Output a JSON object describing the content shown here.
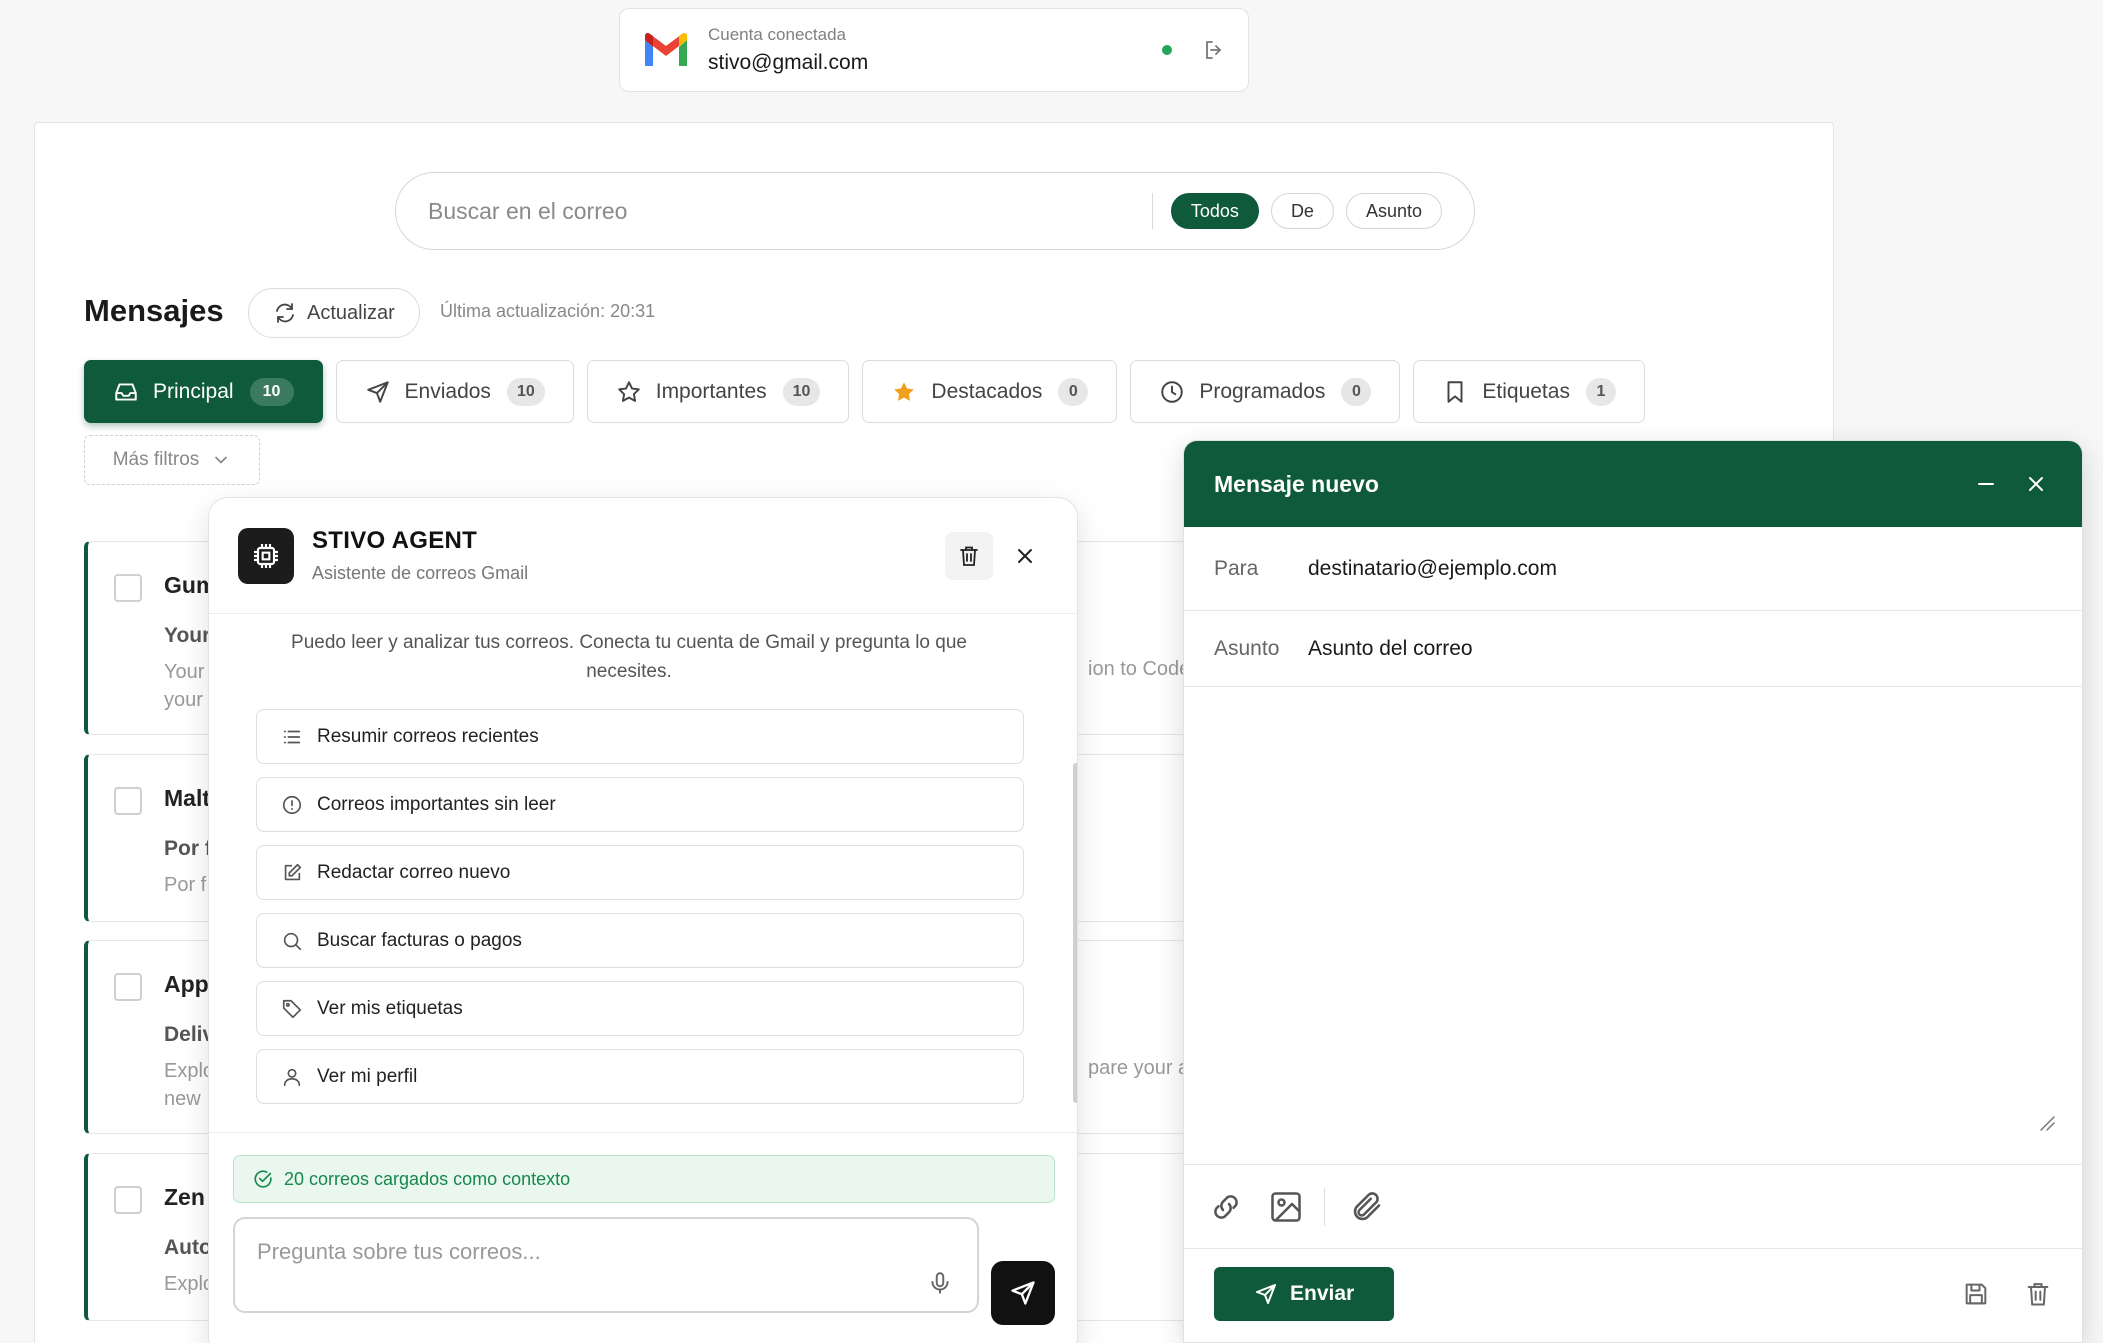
{
  "account": {
    "label": "Cuenta conectada",
    "email": "stivo@gmail.com"
  },
  "search": {
    "placeholder": "Buscar en el correo",
    "filters": [
      "Todos",
      "De",
      "Asunto"
    ]
  },
  "header": {
    "title": "Mensajes",
    "refresh_label": "Actualizar",
    "last_update": "Última actualización: 20:31"
  },
  "tabs": [
    {
      "label": "Principal",
      "count": "10",
      "icon": "inbox-icon"
    },
    {
      "label": "Enviados",
      "count": "10",
      "icon": "send-icon"
    },
    {
      "label": "Importantes",
      "count": "10",
      "icon": "star-outline-icon"
    },
    {
      "label": "Destacados",
      "count": "0",
      "icon": "star-filled-icon"
    },
    {
      "label": "Programados",
      "count": "0",
      "icon": "clock-icon"
    },
    {
      "label": "Etiquetas",
      "count": "1",
      "icon": "bookmark-icon"
    }
  ],
  "more_filters": "Más filtros",
  "messages": [
    {
      "from": "Gum",
      "subject": "Your",
      "snippet": "Your",
      "snippet2": "your",
      "right": "ion to Code"
    },
    {
      "from": "Malt",
      "subject": "Por f",
      "snippet": "Por f"
    },
    {
      "from": "App",
      "subject": "Deliv",
      "snippet": "Explo",
      "snippet2": "new",
      "right": "pare your a"
    },
    {
      "from": "Zen",
      "subject": "Auto",
      "snippet": "Explo"
    }
  ],
  "agent": {
    "name": "STIVO AGENT",
    "subtitle": "Asistente de correos Gmail",
    "intro": "Puedo leer y analizar tus correos. Conecta tu cuenta de Gmail y pregunta lo que necesites.",
    "suggestions": [
      {
        "label": "Resumir correos recientes",
        "icon": "list-icon"
      },
      {
        "label": "Correos importantes sin leer",
        "icon": "alert-circle-icon"
      },
      {
        "label": "Redactar correo nuevo",
        "icon": "edit-icon"
      },
      {
        "label": "Buscar facturas o pagos",
        "icon": "search-icon"
      },
      {
        "label": "Ver mis etiquetas",
        "icon": "tag-icon"
      },
      {
        "label": "Ver mi perfil",
        "icon": "user-icon"
      }
    ],
    "context_status": "20 correos cargados como contexto",
    "input_placeholder": "Pregunta sobre tus correos..."
  },
  "compose": {
    "title": "Mensaje nuevo",
    "to_label": "Para",
    "to_value": "destinatario@ejemplo.com",
    "subject_label": "Asunto",
    "subject_value": "Asunto del correo",
    "send_label": "Enviar"
  },
  "colors": {
    "brand": "#0f5a3b",
    "success": "#16884a",
    "status_dot": "#22a65a"
  }
}
